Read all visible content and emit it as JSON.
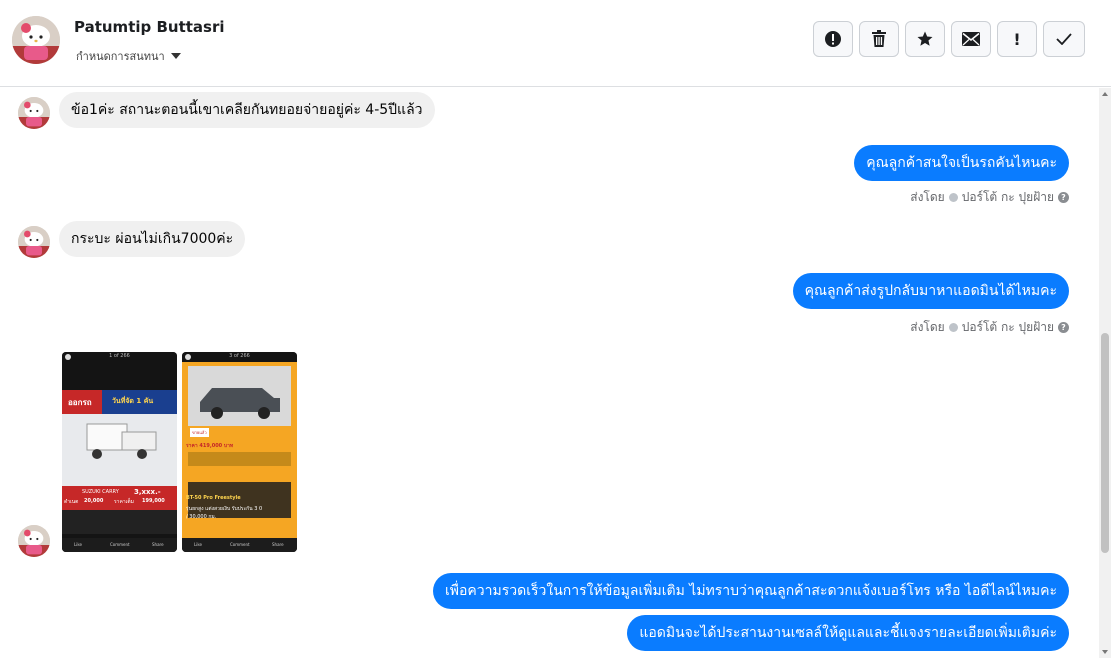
{
  "header": {
    "name": "Patumtip Buttasri",
    "subtitle": "กำหนดการสนทนา",
    "actions": [
      "alert-circle-icon",
      "trash-icon",
      "star-icon",
      "envelope-icon",
      "exclamation-icon",
      "check-icon"
    ],
    "exclaim_text": "!"
  },
  "thread": {
    "msg1": "ข้อ1ค่ะ สถานะตอนนี้เขาเคลียกันทยอยจ่ายอยู่ค่ะ 4-5ปีแล้ว",
    "msg2": "คุณลูกค้าสนใจเป็นรถคันไหนคะ",
    "sent_by_label": "ส่งโดย",
    "sent_by_name": "ปอร์โต้ กะ ปุยฝ้าย",
    "msg3": "กระบะ ผ่อนไม่เกิน7000ค่ะ",
    "msg4": "คุณลูกค้าส่งรูปกลับมาหาแอดมินได้ไหมคะ",
    "msg5": "เพื่อความรวดเร็วในการให้ข้อมูลเพิ่มเติม ไม่ทราบว่าคุณลูกค้าสะดวกแจ้งเบอร์โทร หรือ ไอดีไลน์ไหมคะ",
    "msg6": "แอดมินจะได้ประสานงานเซลล์ให้ดูแลและชี้แจงรายละเอียดเพิ่มเติมค่ะ"
  },
  "screenshots": {
    "shot1": {
      "counter": "1 of 266",
      "banner_left": "ออกรถ",
      "banner_right": "วันที่จัด 1 คัน",
      "model": "SUZUKI CARRY",
      "price_tag": "3,xxx.-",
      "label_a": "ดำเนต",
      "val_a": "20,000",
      "label_b": "ราคาเต็ม",
      "val_b": "199,000",
      "like": "Like",
      "comment": "Comment",
      "share": "Share"
    },
    "shot2": {
      "counter": "3 of 266",
      "badge": "ขายแล้ว",
      "price": "ราคา 419,000 บาท",
      "model": "BT-50 Pro Freestyle",
      "line1": "รุ่นยกสูง แต่งสวยเงิบ รับประกัน 3 0",
      "line2": "/ 30,000 กม.",
      "like": "Like",
      "comment": "Comment",
      "share": "Share"
    }
  },
  "colors": {
    "outgoing": "#0a7cff",
    "incoming": "#f0f0f0",
    "muted": "#65676b"
  }
}
